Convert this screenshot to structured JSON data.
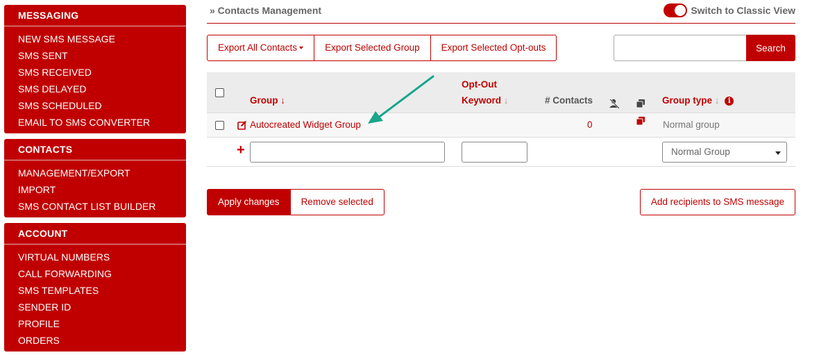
{
  "sidebar": {
    "messaging": {
      "title": "MESSAGING",
      "items": [
        "NEW SMS MESSAGE",
        "SMS SENT",
        "SMS RECEIVED",
        "SMS DELAYED",
        "SMS SCHEDULED",
        "EMAIL TO SMS CONVERTER"
      ]
    },
    "contacts": {
      "title": "CONTACTS",
      "items": [
        "MANAGEMENT/EXPORT",
        "IMPORT",
        "SMS CONTACT LIST BUILDER"
      ]
    },
    "account": {
      "title": "ACCOUNT",
      "items": [
        "VIRTUAL NUMBERS",
        "CALL FORWARDING",
        "SMS TEMPLATES",
        "SENDER ID",
        "PROFILE",
        "ORDERS"
      ]
    }
  },
  "header": {
    "breadcrumb": "» Contacts Management",
    "toggle_label": "Switch to Classic View",
    "toggle_on": true
  },
  "toolbar": {
    "export_all": "Export All Contacts",
    "export_group": "Export Selected Group",
    "export_optouts": "Export Selected Opt-outs",
    "search_placeholder": "",
    "search_button": "Search"
  },
  "table": {
    "headers": {
      "group": "Group",
      "optout_line1": "Opt-Out",
      "optout_line2": "Keyword",
      "contacts": "# Contacts",
      "group_type": "Group type"
    },
    "rows": [
      {
        "group": "Autocreated Widget Group",
        "keyword": "",
        "contacts": "0",
        "group_type": "Normal group"
      }
    ],
    "new_row": {
      "group_type_selected": "Normal Group"
    }
  },
  "actions": {
    "apply": "Apply changes",
    "remove": "Remove selected",
    "add_recipients": "Add recipients to SMS message"
  },
  "colors": {
    "brand": "#c00000",
    "annotation_arrow": "#1aa68a"
  },
  "icons": [
    "edit-icon",
    "hide-contact-icon",
    "copy-icon",
    "info-icon",
    "sort-arrow-icon",
    "plus-icon",
    "annotation-arrow-icon"
  ]
}
